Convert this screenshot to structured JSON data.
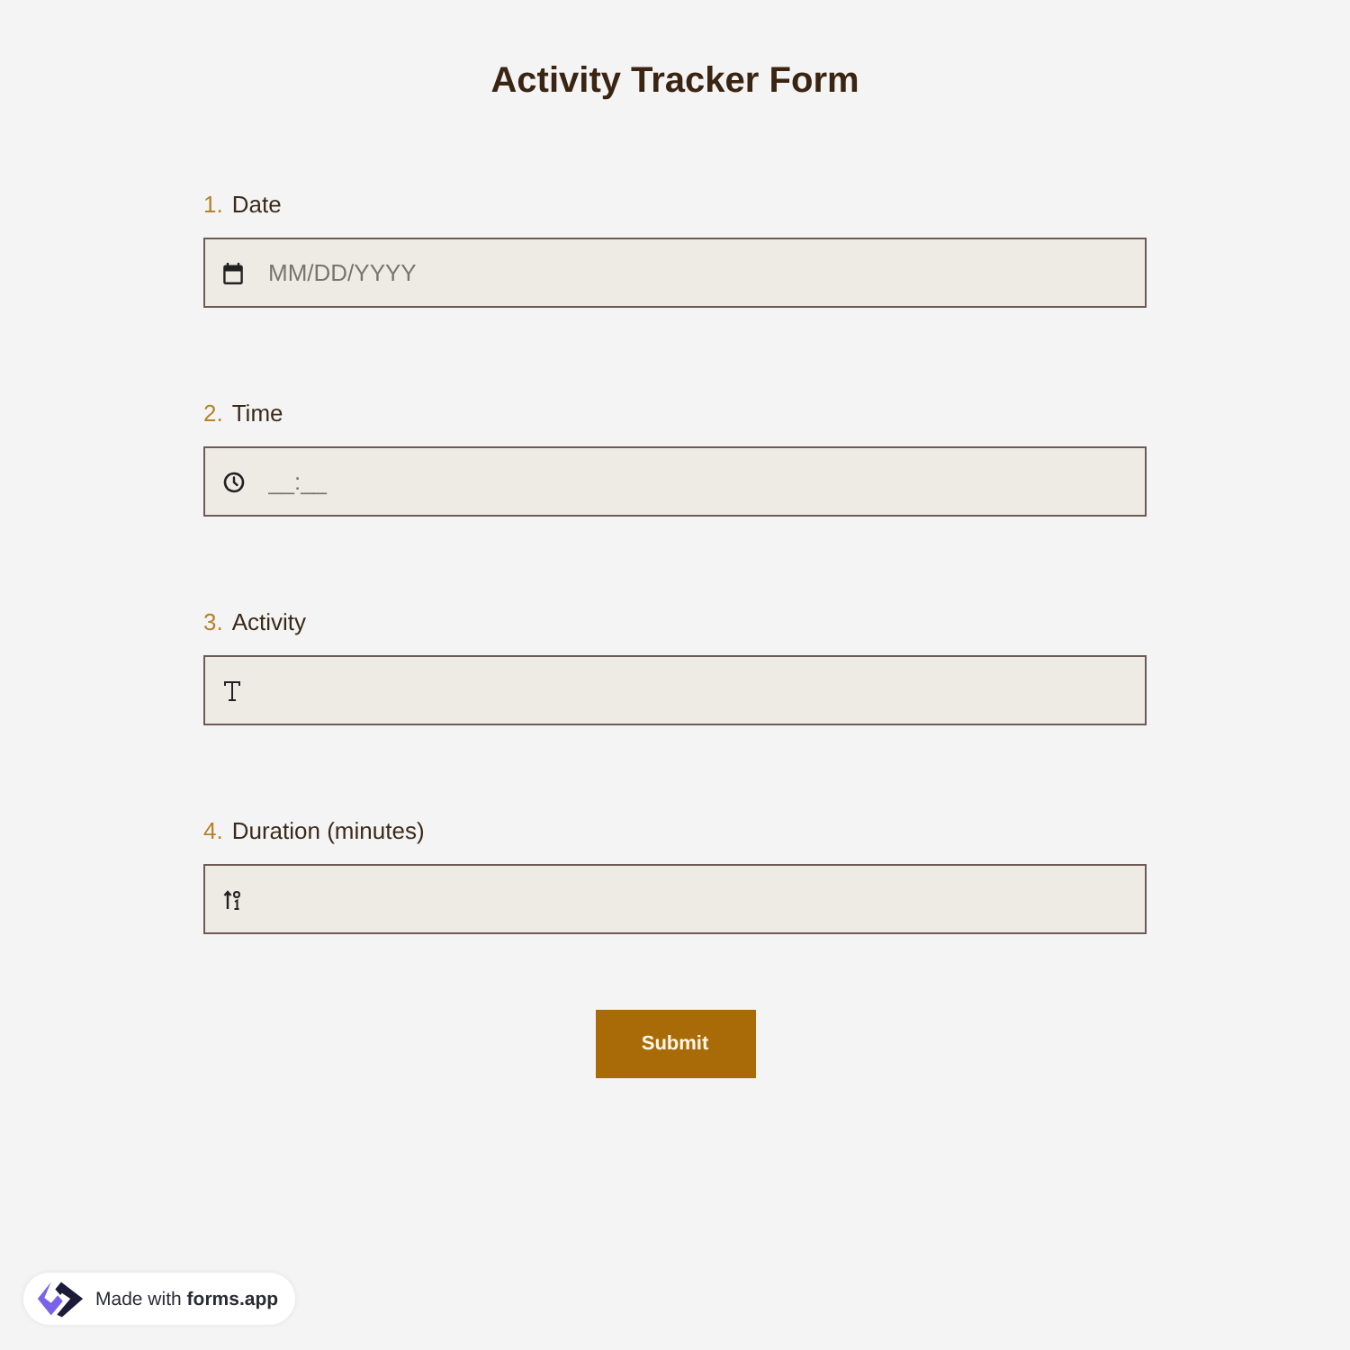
{
  "title": "Activity Tracker Form",
  "questions": [
    {
      "number": "1.",
      "label": "Date",
      "kind": "date",
      "placeholder": "MM/DD/YYYY"
    },
    {
      "number": "2.",
      "label": "Time",
      "kind": "time",
      "placeholder": "__:__"
    },
    {
      "number": "3.",
      "label": "Activity",
      "kind": "text"
    },
    {
      "number": "4.",
      "label": "Duration (minutes)",
      "kind": "number"
    }
  ],
  "submit_button": {
    "label": "Submit"
  },
  "badge": {
    "text": "Made with **forms.app**"
  }
}
